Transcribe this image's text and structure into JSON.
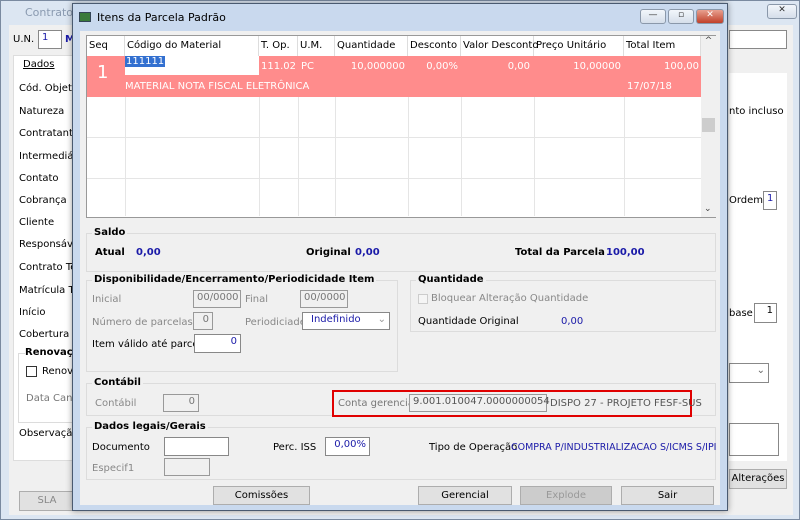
{
  "background_window": {
    "title": "Contratos",
    "un_label": "U.N.",
    "un_value": "1",
    "un_extra": "M",
    "tab": "Dados",
    "labels": [
      "Cód. Objeto",
      "Natureza",
      "Contratante",
      "Intermediária",
      "Contato",
      "Cobrança",
      "Cliente",
      "Responsável",
      "Contrato Terc",
      "Matrícula Terc",
      "Início",
      "Cobertura"
    ],
    "renovacao_title": "Renovação",
    "renovacao_check": "Renova",
    "data_cancel": "Data Cance",
    "observacao": "Observação",
    "right_text": "nto incluso",
    "ordem_label": "Ordem",
    "ordem_value": "1",
    "base_label": "base",
    "base_value": "1",
    "alteracoes_button": "Alterações",
    "sla_button": "SLA",
    "close": "✕"
  },
  "dialog": {
    "title": "Itens da Parcela Padrão",
    "minimize": "—",
    "maximize": "▫",
    "close": "✕",
    "grid": {
      "columns": [
        "Seq",
        "Código do Material",
        "T. Op.",
        "U.M.",
        "Quantidade",
        "Desconto",
        "Valor Desconto",
        "Preço Unitário",
        "Total Item"
      ],
      "rows": [
        {
          "seq": "1",
          "codigo": "111111",
          "t_op": "111.02",
          "um": "PC",
          "quantidade": "10,000000",
          "desconto": "0,00%",
          "valor_desconto": "0,00",
          "preco_unitario": "10,00000",
          "total_item": "100,00",
          "descricao": "MATERIAL NOTA FISCAL ELETRÔNICA",
          "data": "17/07/18"
        }
      ],
      "row_color": "#ff8c8c"
    },
    "saldo": {
      "title": "Saldo",
      "atual_label": "Atual",
      "atual": "0,00",
      "original_label": "Original",
      "original": "0,00",
      "total_label": "Total da Parcela",
      "total": "100,00"
    },
    "disp": {
      "title": "Disponibilidade/Encerramento/Periodicidade Item",
      "inicial_label": "Inicial",
      "inicial": "00/0000",
      "final_label": "Final",
      "final": "00/0000",
      "num_parcelas_label": "Número de parcelas",
      "num_parcelas": "0",
      "periodicidade_label": "Periodiciade",
      "periodicidade": "Indefinido",
      "item_valido_label": "Item válido até parcela",
      "item_valido": "0"
    },
    "quantidade": {
      "title": "Quantidade",
      "bloquear_label": "Bloquear Alteração Quantidade",
      "original_label": "Quantidade Original",
      "original": "0,00"
    },
    "contabil": {
      "title": "Contábil",
      "contabil_label": "Contábil",
      "contabil": "0",
      "conta_label": "Conta gerencial",
      "conta": "9.001.010047.0000000054",
      "conta_desc": "DISPO 27 - PROJETO FESF-SUS",
      "highlight_color": "#e00000"
    },
    "dados_legais": {
      "title": "Dados legais/Gerais",
      "documento_label": "Documento",
      "documento": "",
      "perc_iss_label": "Perc. ISS",
      "perc_iss": "0,00%",
      "tipo_op_label": "Tipo de Operação",
      "tipo_op": "COMPRA P/INDUSTRIALIZACAO S/ICMS S/IPI",
      "especif_label": "Especif1",
      "especif": ""
    },
    "buttons": {
      "comissoes": "Comissões",
      "gerencial": "Gerencial",
      "explode": "Explode",
      "sair": "Sair"
    }
  }
}
